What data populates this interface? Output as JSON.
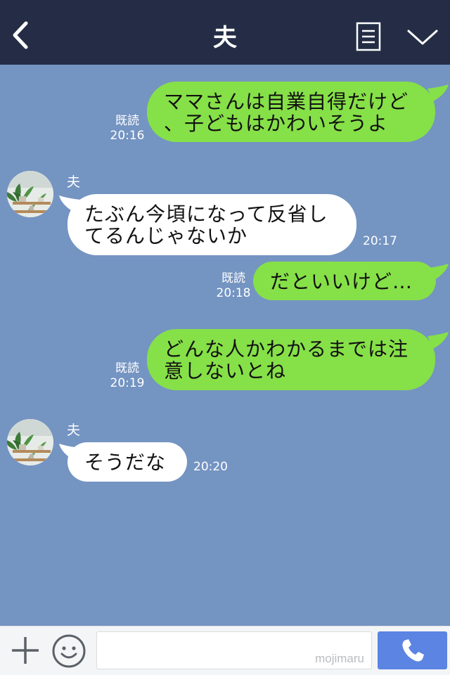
{
  "header": {
    "title": "夫"
  },
  "messages": [
    {
      "from": "me",
      "lines": [
        "ママさんは自業自得だけど",
        "、子どもはかわいそうよ"
      ],
      "read_label": "既読",
      "time": "20:16"
    },
    {
      "from": "them",
      "sender": "夫",
      "lines": [
        "たぶん今頃になって反省し",
        "てるんじゃないか"
      ],
      "time": "20:17"
    },
    {
      "from": "me",
      "lines": [
        "だといいけど…"
      ],
      "read_label": "既読",
      "time": "20:18"
    },
    {
      "from": "me",
      "lines": [
        "どんな人かわかるまでは注",
        "意しないとね"
      ],
      "read_label": "既読",
      "time": "20:19"
    },
    {
      "from": "them",
      "sender": "夫",
      "lines": [
        "そうだな"
      ],
      "time": "20:20"
    }
  ],
  "footer": {
    "input_value": "",
    "watermark": "mojimaru"
  },
  "colors": {
    "header_bg": "#242d45",
    "chat_bg": "#7494c2",
    "my_bubble": "#86e048",
    "their_bubble": "#ffffff",
    "call_button": "#5b84e3"
  },
  "icons": [
    "back-icon",
    "notes-icon",
    "chevron-down-icon",
    "plus-icon",
    "smile-icon",
    "phone-icon"
  ]
}
